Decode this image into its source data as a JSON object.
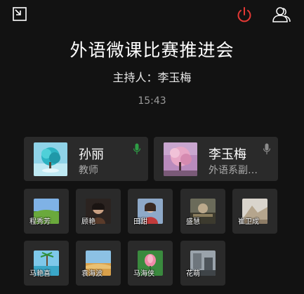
{
  "meeting": {
    "title": "外语微课比赛推进会",
    "host": "主持人：李玉梅",
    "time": "15:43"
  },
  "icons": {
    "minimize": "minimize-window-icon",
    "hangup": "power-hangup-icon",
    "members": "members-icon",
    "mic": "microphone-icon"
  },
  "colors": {
    "background": "#121212",
    "card": "#2a2a2a",
    "hangup": "#e53935",
    "mic_active": "#2e9d45",
    "mic_idle": "#8a8a8a"
  },
  "speakers": [
    {
      "name": "孙丽",
      "role": "教师",
      "mic": "active"
    },
    {
      "name": "李玉梅",
      "role": "外语系副…",
      "mic": "idle"
    }
  ],
  "participants": [
    {
      "name": "程秀芳"
    },
    {
      "name": "顾艳"
    },
    {
      "name": "田甜"
    },
    {
      "name": "盛慧"
    },
    {
      "name": "崔卫成"
    },
    {
      "name": "马艳喜"
    },
    {
      "name": "袁海波"
    },
    {
      "name": "马海侠"
    },
    {
      "name": "花萌"
    }
  ]
}
